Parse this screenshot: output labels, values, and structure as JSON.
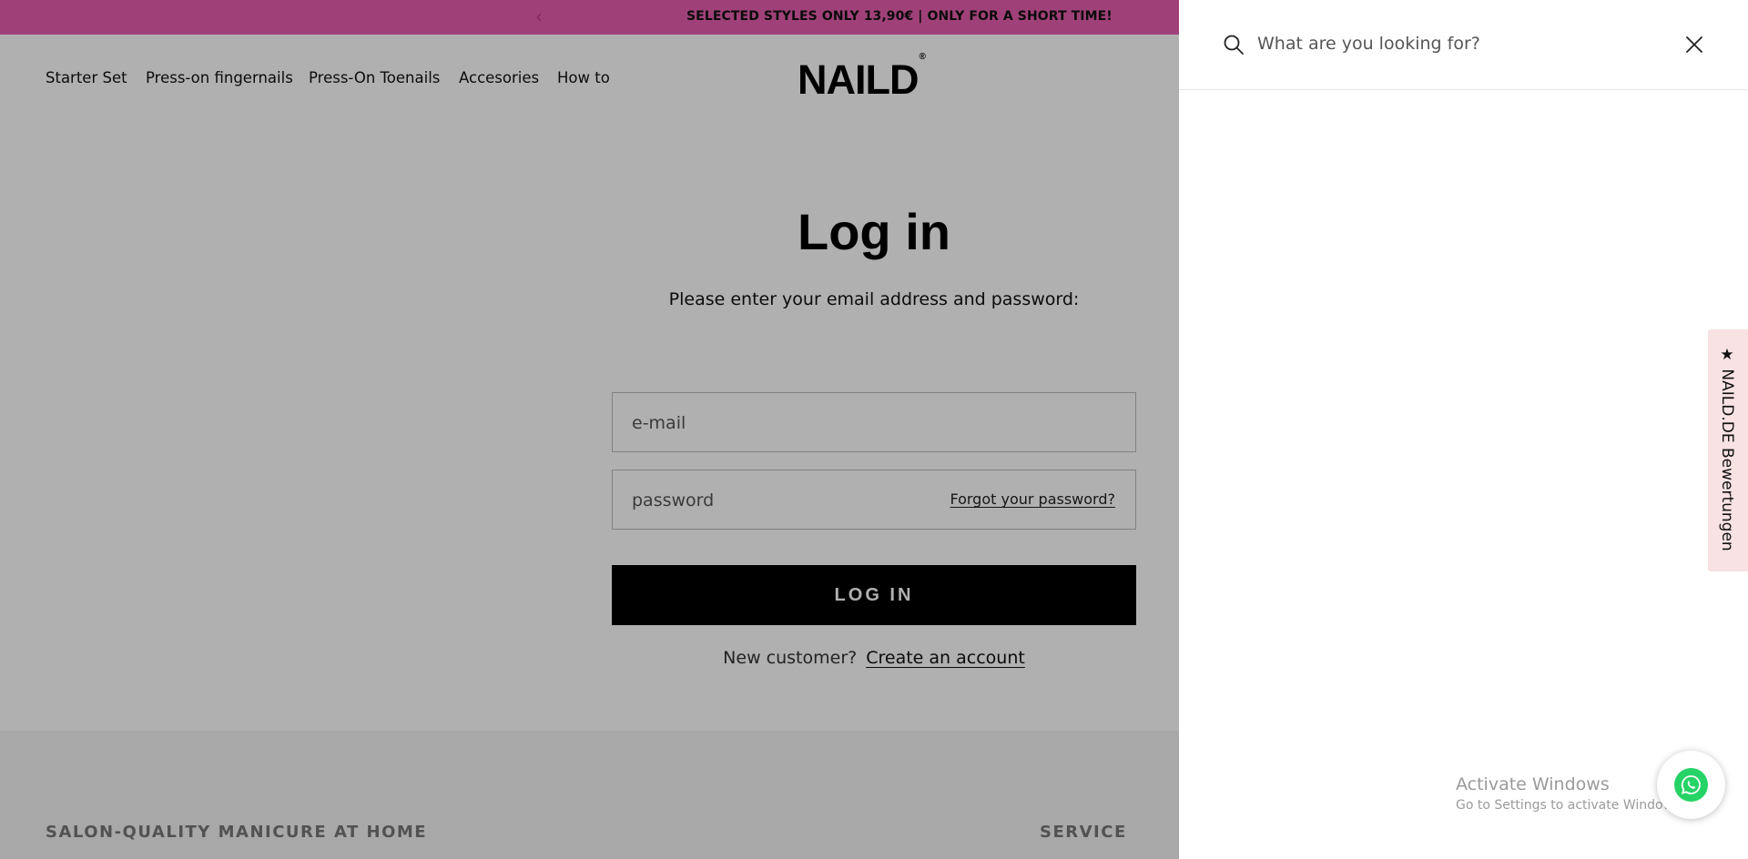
{
  "announcement": {
    "text": "SELECTED STYLES ONLY 13,90€ | ONLY FOR A SHORT TIME!",
    "bg": "#e65faf"
  },
  "nav": {
    "items": [
      {
        "label": "Starter Set"
      },
      {
        "label": "Press-on fingernails"
      },
      {
        "label": "Press-On Toenails"
      },
      {
        "label": "Accesories"
      },
      {
        "label": "How to"
      }
    ]
  },
  "logo": {
    "text": "NAILD",
    "mark": "®"
  },
  "login": {
    "title": "Log in",
    "subtitle": "Please enter your email address and password:",
    "email_placeholder": "e-mail",
    "password_placeholder": "password",
    "forgot_label": "Forgot your password?",
    "button_label": "LOG IN",
    "new_customer_label": "New customer?",
    "create_account_label": "Create an account"
  },
  "footer": {
    "left_heading": "SALON-QUALITY MANICURE AT HOME",
    "right_heading": "SERVICE"
  },
  "search": {
    "placeholder": "What are you looking for?"
  },
  "reviews_tab": {
    "label": "★ NAILD.DE Bewertungen"
  },
  "windows_watermark": {
    "line1": "Activate Windows",
    "line2": "Go to Settings to activate Windows."
  },
  "colors": {
    "accent_pink": "#e65faf",
    "whatsapp_green": "#25d366",
    "button_black": "#000000"
  }
}
